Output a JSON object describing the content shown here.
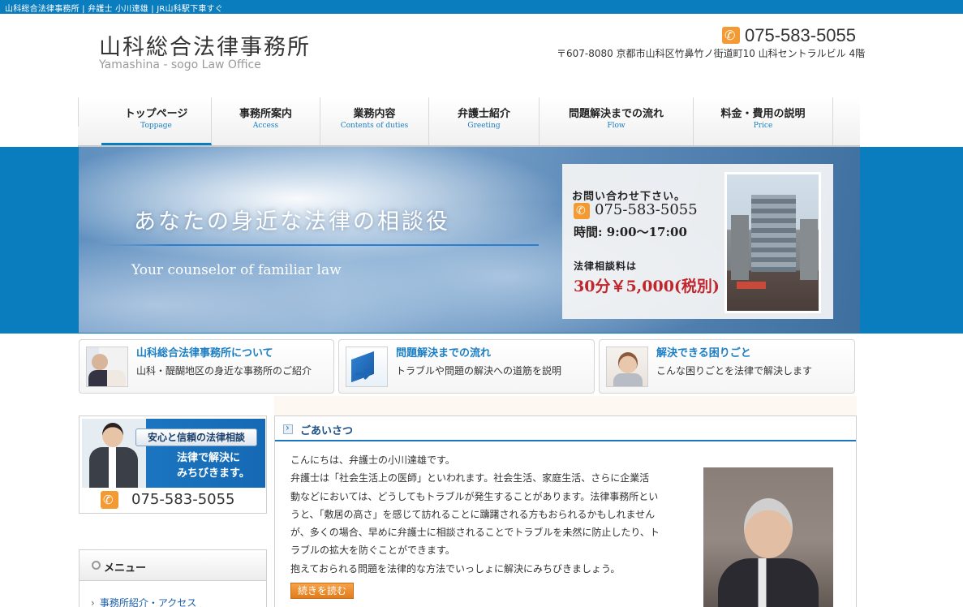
{
  "topbar": {
    "text": "山科総合法律事務所 | 弁護士 小川達雄 | JR山科駅下車すぐ"
  },
  "header": {
    "logo_jp": "山科総合法律事務所",
    "logo_en": "Yamashina - sogo Law Office",
    "phone": "075-583-5055",
    "address": "〒607-8080 京都市山科区竹鼻竹ノ街道町10  山科セントラルビル 4階"
  },
  "nav": {
    "items": [
      {
        "jp": "トップページ",
        "en": "Toppage"
      },
      {
        "jp": "事務所案内",
        "en": "Access"
      },
      {
        "jp": "業務内容",
        "en": "Contents of duties"
      },
      {
        "jp": "弁護士紹介",
        "en": "Greeting"
      },
      {
        "jp": "問題解決までの流れ",
        "en": "Flow"
      },
      {
        "jp": "料金・費用の説明",
        "en": "Price"
      }
    ],
    "active_index": 0
  },
  "hero": {
    "title": "あなたの身近な法律の相談役",
    "subtitle": "Your counselor of familiar law",
    "contact_prompt": "お問い合わせ下さい。",
    "phone": "075-583-5055",
    "hours": "時間: 9:00～17:00",
    "fee_label": "法律相談料は",
    "fee": "30分￥5,000(税別)"
  },
  "features": [
    {
      "title": "山科総合法律事務所について",
      "desc": "山科・醍醐地区の身近な事務所のご紹介"
    },
    {
      "title": "問題解決までの流れ",
      "desc": "トラブルや問題の解決への道筋を説明"
    },
    {
      "title": "解決できる困りごと",
      "desc": "こんな困りごとを法律で解決します"
    }
  ],
  "sidebar": {
    "banner": {
      "tag": "安心と信頼の法律相談",
      "line1": "法律で解決に",
      "line2": "みちびきます。",
      "phone": "075-583-5055"
    },
    "menu_title": "メニュー",
    "menu_items": [
      "事務所紹介・アクセス"
    ]
  },
  "greeting": {
    "heading": "ごあいさつ",
    "lines": [
      "こんにちは、弁護士の小川達雄です。",
      "弁護士は「社会生活上の医師」といわれます。社会生活、家庭生活、さらに企業活",
      "動などにおいては、どうしてもトラブルが発生することがあります。法律事務所とい",
      "うと、「敷居の高さ」を感じて訪れることに躊躇される方もおられるかもしれません",
      "が、多くの場合、早めに弁護士に相談されることでトラブルを未然に防止したり、ト",
      "ラブルの拡大を防ぐことができます。",
      "抱えておられる問題を法律的な方法でいっしょに解決にみちびきましょう。"
    ],
    "read_more": "続きを読む"
  },
  "colors": {
    "brand_blue": "#0a7dbf",
    "accent_orange": "#f39a32",
    "fee_red": "#c0272d"
  }
}
